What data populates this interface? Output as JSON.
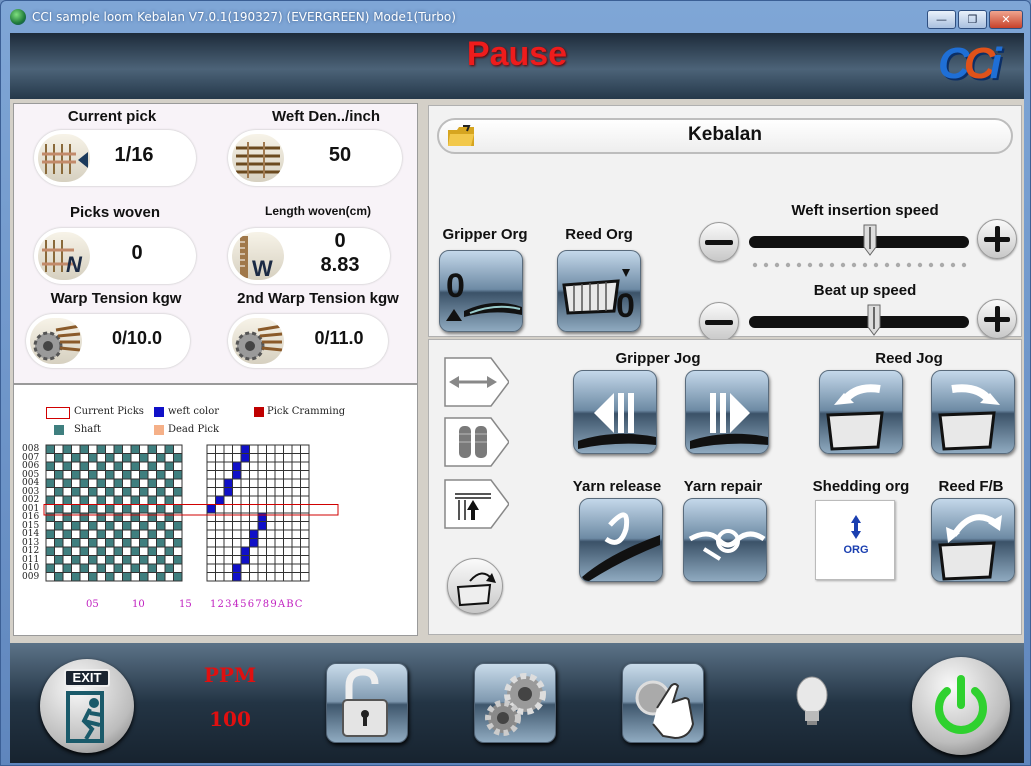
{
  "window": {
    "title": "CCI sample loom Kebalan V7.0.1(190327)  (EVERGREEN) Mode1(Turbo)",
    "min_glyph": "—",
    "max_glyph": "❐",
    "close_glyph": "✕"
  },
  "header": {
    "status": "Pause",
    "logo": "CCI"
  },
  "counters": {
    "current_pick": {
      "label": "Current pick",
      "value": "1/16"
    },
    "weft_density": {
      "label": "Weft Den../inch",
      "value": "50"
    },
    "picks_woven": {
      "label": "Picks woven",
      "value": "0"
    },
    "length_woven": {
      "label": "Length woven(cm)",
      "value_top": "0",
      "value_bottom": "8.83",
      "icon_letter": "W"
    },
    "warp_tension": {
      "label": "Warp Tension kgw",
      "value": "0/10.0"
    },
    "warp_tension2": {
      "label": "2nd Warp Tension kgw",
      "value": "0/11.0"
    }
  },
  "pattern": {
    "legend": {
      "current_picks": "Current Picks",
      "weft_color": "weft color",
      "pick_cramming": "Pick Cramming",
      "shaft": "Shaft",
      "dead_pick": "Dead Pick"
    },
    "row_labels": [
      "008",
      "007",
      "006",
      "005",
      "004",
      "003",
      "002",
      "001",
      "016",
      "015",
      "014",
      "013",
      "012",
      "011",
      "010",
      "009"
    ],
    "shaft_col_labels": [
      "05",
      "10",
      "15"
    ],
    "weft_col_labels": "1 2 3 4 5 6 7 8 9 A B C",
    "weft_marks": [
      [
        0,
        4
      ],
      [
        1,
        4
      ],
      [
        2,
        3
      ],
      [
        3,
        3
      ],
      [
        4,
        2
      ],
      [
        5,
        2
      ],
      [
        6,
        1
      ],
      [
        7,
        0
      ],
      [
        8,
        6
      ],
      [
        9,
        6
      ],
      [
        10,
        5
      ],
      [
        11,
        5
      ],
      [
        12,
        4
      ],
      [
        13,
        4
      ],
      [
        14,
        3
      ],
      [
        15,
        3
      ]
    ],
    "highlight_row": 7,
    "colors": {
      "shaft": "#3f7f7f",
      "weft": "#1010c8",
      "cramming": "#c00000",
      "dead": "#f5b088",
      "current": "#d00000"
    }
  },
  "file": {
    "name": "Kebalan"
  },
  "controls": {
    "gripper_org": "Gripper Org",
    "reed_org": "Reed Org",
    "gripper_org_digit": "0",
    "reed_org_digit": "0",
    "weft_insertion_speed": "Weft insertion speed",
    "beat_up_speed": "Beat up speed",
    "weft_speed_level": 0.55,
    "beat_speed_level": 0.57,
    "minus": "−",
    "plus": "+",
    "gripper_jog": "Gripper Jog",
    "reed_jog": "Reed Jog",
    "yarn_release": "Yarn release",
    "yarn_repair": "Yarn repair",
    "shedding_org": "Shedding org",
    "shedding_org_btn": "ORG",
    "reed_fb": "Reed F/B"
  },
  "bottom": {
    "exit": "EXIT",
    "ppm_label": "PPM",
    "ppm_value": "100"
  }
}
